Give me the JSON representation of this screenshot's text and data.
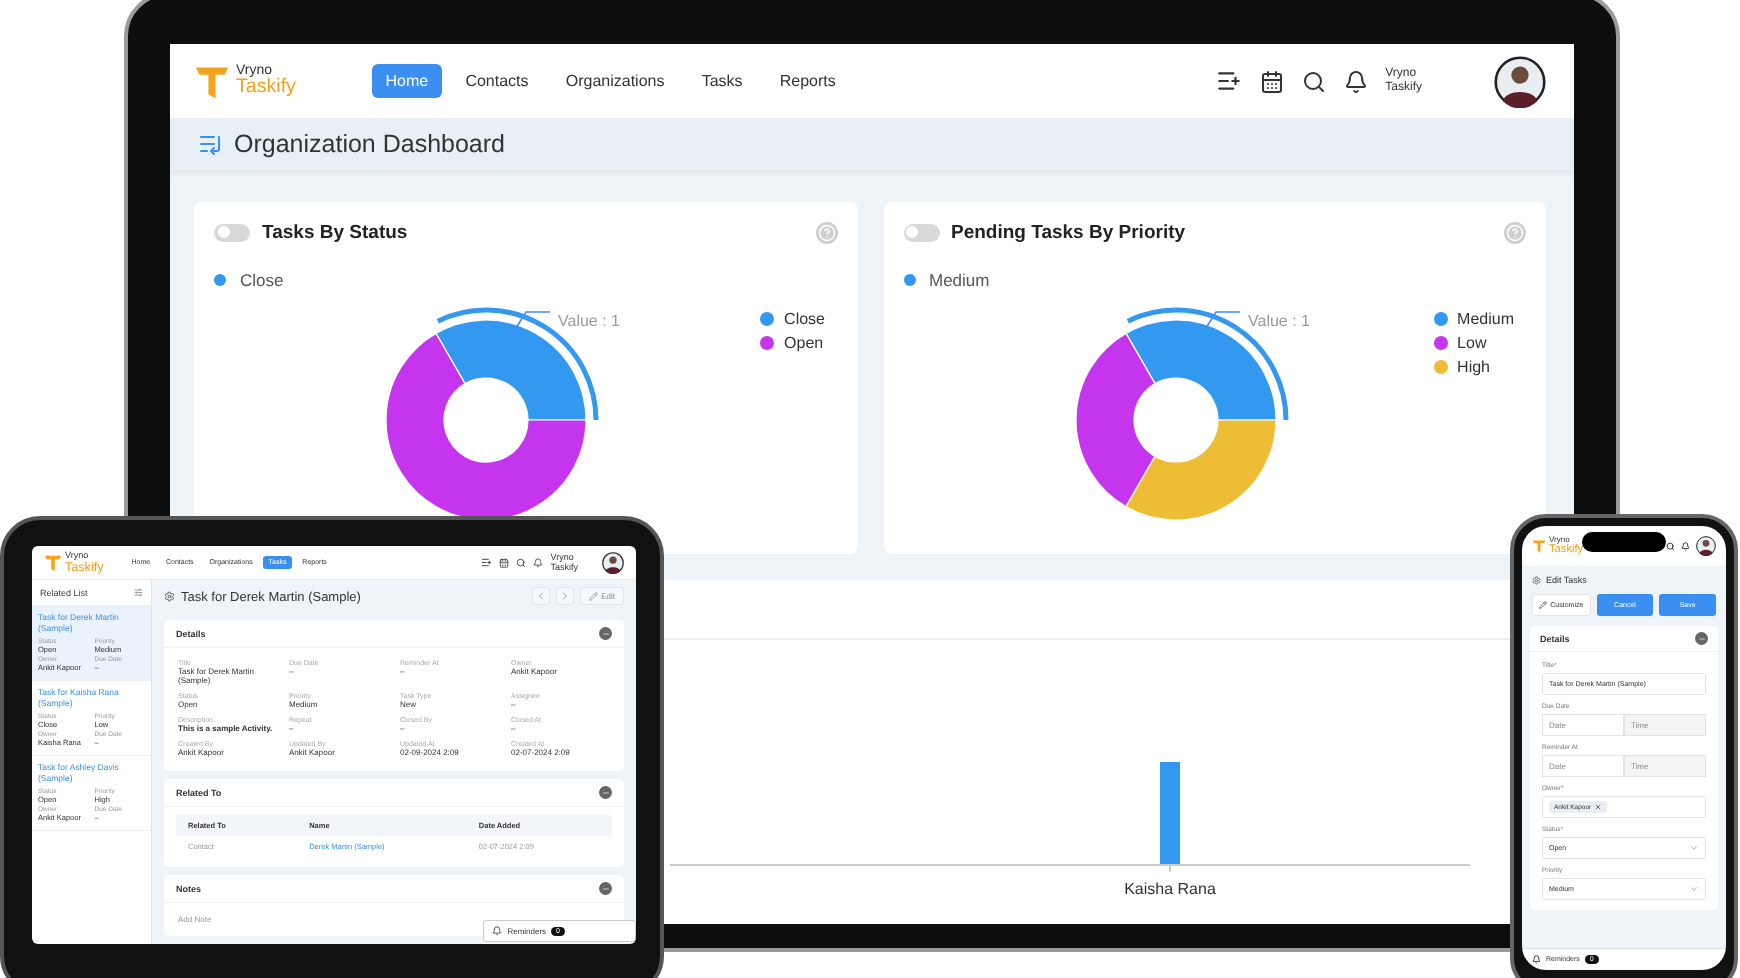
{
  "laptop": {
    "logo": [
      "Vryno",
      "Taskify"
    ],
    "nav": [
      {
        "label": "Home",
        "selected": true
      },
      {
        "label": "Contacts",
        "selected": false
      },
      {
        "label": "Organizations",
        "selected": false
      },
      {
        "label": "Tasks",
        "selected": false
      },
      {
        "label": "Reports",
        "selected": false
      }
    ],
    "user": [
      "Vryno",
      "Taskify"
    ],
    "page_title": "Organization Dashboard",
    "charts": [
      {
        "title": "Tasks By Status",
        "toggle_on": false,
        "selected_series": "Close",
        "tooltip": "Value : 1",
        "legend": [
          {
            "label": "Close",
            "color": "#3398f0"
          },
          {
            "label": "Open",
            "color": "#c535ee"
          }
        ]
      },
      {
        "title": "Pending Tasks By Priority",
        "toggle_on": false,
        "selected_series": "Medium",
        "tooltip": "Value : 1",
        "legend": [
          {
            "label": "Medium",
            "color": "#3398f0"
          },
          {
            "label": "Low",
            "color": "#c535ee"
          },
          {
            "label": "High",
            "color": "#ecbd35"
          }
        ]
      }
    ],
    "bar_chart": {
      "category": "Kaisha Rana"
    }
  },
  "tablet": {
    "logo": [
      "Vryno",
      "Taskify"
    ],
    "nav": [
      {
        "label": "Home",
        "selected": false
      },
      {
        "label": "Contacts",
        "selected": false
      },
      {
        "label": "Organizations",
        "selected": false
      },
      {
        "label": "Tasks",
        "selected": true
      },
      {
        "label": "Reports",
        "selected": false
      }
    ],
    "user": [
      "Vryno",
      "Taskify"
    ],
    "sidebar": {
      "title": "Related List",
      "items": [
        {
          "title": "Task for Derek Martin (Sample)",
          "selected": true,
          "fields": [
            {
              "label": "Status",
              "value": "Open"
            },
            {
              "label": "Priority",
              "value": "Medium"
            },
            {
              "label": "Owner",
              "value": "Ankit Kapoor"
            },
            {
              "label": "Due Date",
              "value": "–"
            }
          ]
        },
        {
          "title": "Task for Kaisha Rana (Sample)",
          "selected": false,
          "fields": [
            {
              "label": "Status",
              "value": "Close"
            },
            {
              "label": "Priority",
              "value": "Low"
            },
            {
              "label": "Owner",
              "value": "Kaisha Rana"
            },
            {
              "label": "Due Date",
              "value": "–"
            }
          ]
        },
        {
          "title": "Task for Ashley Davis (Sample)",
          "selected": false,
          "fields": [
            {
              "label": "Status",
              "value": "Open"
            },
            {
              "label": "Priority",
              "value": "High"
            },
            {
              "label": "Owner",
              "value": "Ankit Kapoor"
            },
            {
              "label": "Due Date",
              "value": "–"
            }
          ]
        }
      ]
    },
    "record_title": "Task for Derek Martin (Sample)",
    "edit_button": "Edit",
    "details": {
      "title": "Details",
      "fields": [
        {
          "label": "Title",
          "value": "Task for Derek Martin (Sample)",
          "bold": false
        },
        {
          "label": "Due Date",
          "value": "–",
          "bold": false
        },
        {
          "label": "Reminder At",
          "value": "–",
          "bold": false
        },
        {
          "label": "Owner",
          "value": "Ankit Kapoor",
          "bold": false
        },
        {
          "label": "Status",
          "value": "Open",
          "bold": false
        },
        {
          "label": "Priority",
          "value": "Medium",
          "bold": false
        },
        {
          "label": "Task Type",
          "value": "New",
          "bold": false
        },
        {
          "label": "Assignee",
          "value": "–",
          "bold": false
        },
        {
          "label": "Description",
          "value": "This is a sample Activity.",
          "bold": true
        },
        {
          "label": "Repeat",
          "value": "–",
          "bold": false
        },
        {
          "label": "Closed By",
          "value": "–",
          "bold": false
        },
        {
          "label": "Closed At",
          "value": "–",
          "bold": false
        },
        {
          "label": "Created By",
          "value": "Ankit Kapoor",
          "bold": false
        },
        {
          "label": "Updated By",
          "value": "Ankit Kapoor",
          "bold": false
        },
        {
          "label": "Updated At",
          "value": "02-09-2024 2:09",
          "bold": false
        },
        {
          "label": "Created At",
          "value": "02-07-2024 2:09",
          "bold": false
        }
      ]
    },
    "related": {
      "title": "Related To",
      "columns": [
        "Related To",
        "Name",
        "Date Added"
      ],
      "rows": [
        [
          "Contact",
          "Derek Martin (Sample)",
          "02-07-2024 2:09"
        ]
      ]
    },
    "notes": {
      "title": "Notes",
      "placeholder": "Add Note"
    },
    "reminders": {
      "label": "Reminders",
      "count": "0"
    }
  },
  "phone": {
    "logo": [
      "Vryno",
      "Taskify"
    ],
    "title": "Edit Tasks",
    "buttons": [
      {
        "label": "Customize",
        "kind": "plain"
      },
      {
        "label": "Cancel",
        "kind": "primary"
      },
      {
        "label": "Save",
        "kind": "primary"
      }
    ],
    "section": "Details",
    "fields": [
      {
        "kind": "text",
        "label": "Title*",
        "value": "Task for Derek Martin (Sample)"
      },
      {
        "kind": "datetime",
        "label": "Due Date",
        "placeholders": [
          "Date",
          "Time"
        ]
      },
      {
        "kind": "datetime",
        "label": "Reminder At",
        "placeholders": [
          "Date",
          "Time"
        ]
      },
      {
        "kind": "chips",
        "label": "Owner*",
        "chips": [
          "Ankit Kapoor"
        ]
      },
      {
        "kind": "select",
        "label": "Status*",
        "value": "Open"
      },
      {
        "kind": "select",
        "label": "Priority",
        "value": "Medium"
      }
    ],
    "reminders": {
      "label": "Reminders",
      "count": "0"
    }
  }
}
